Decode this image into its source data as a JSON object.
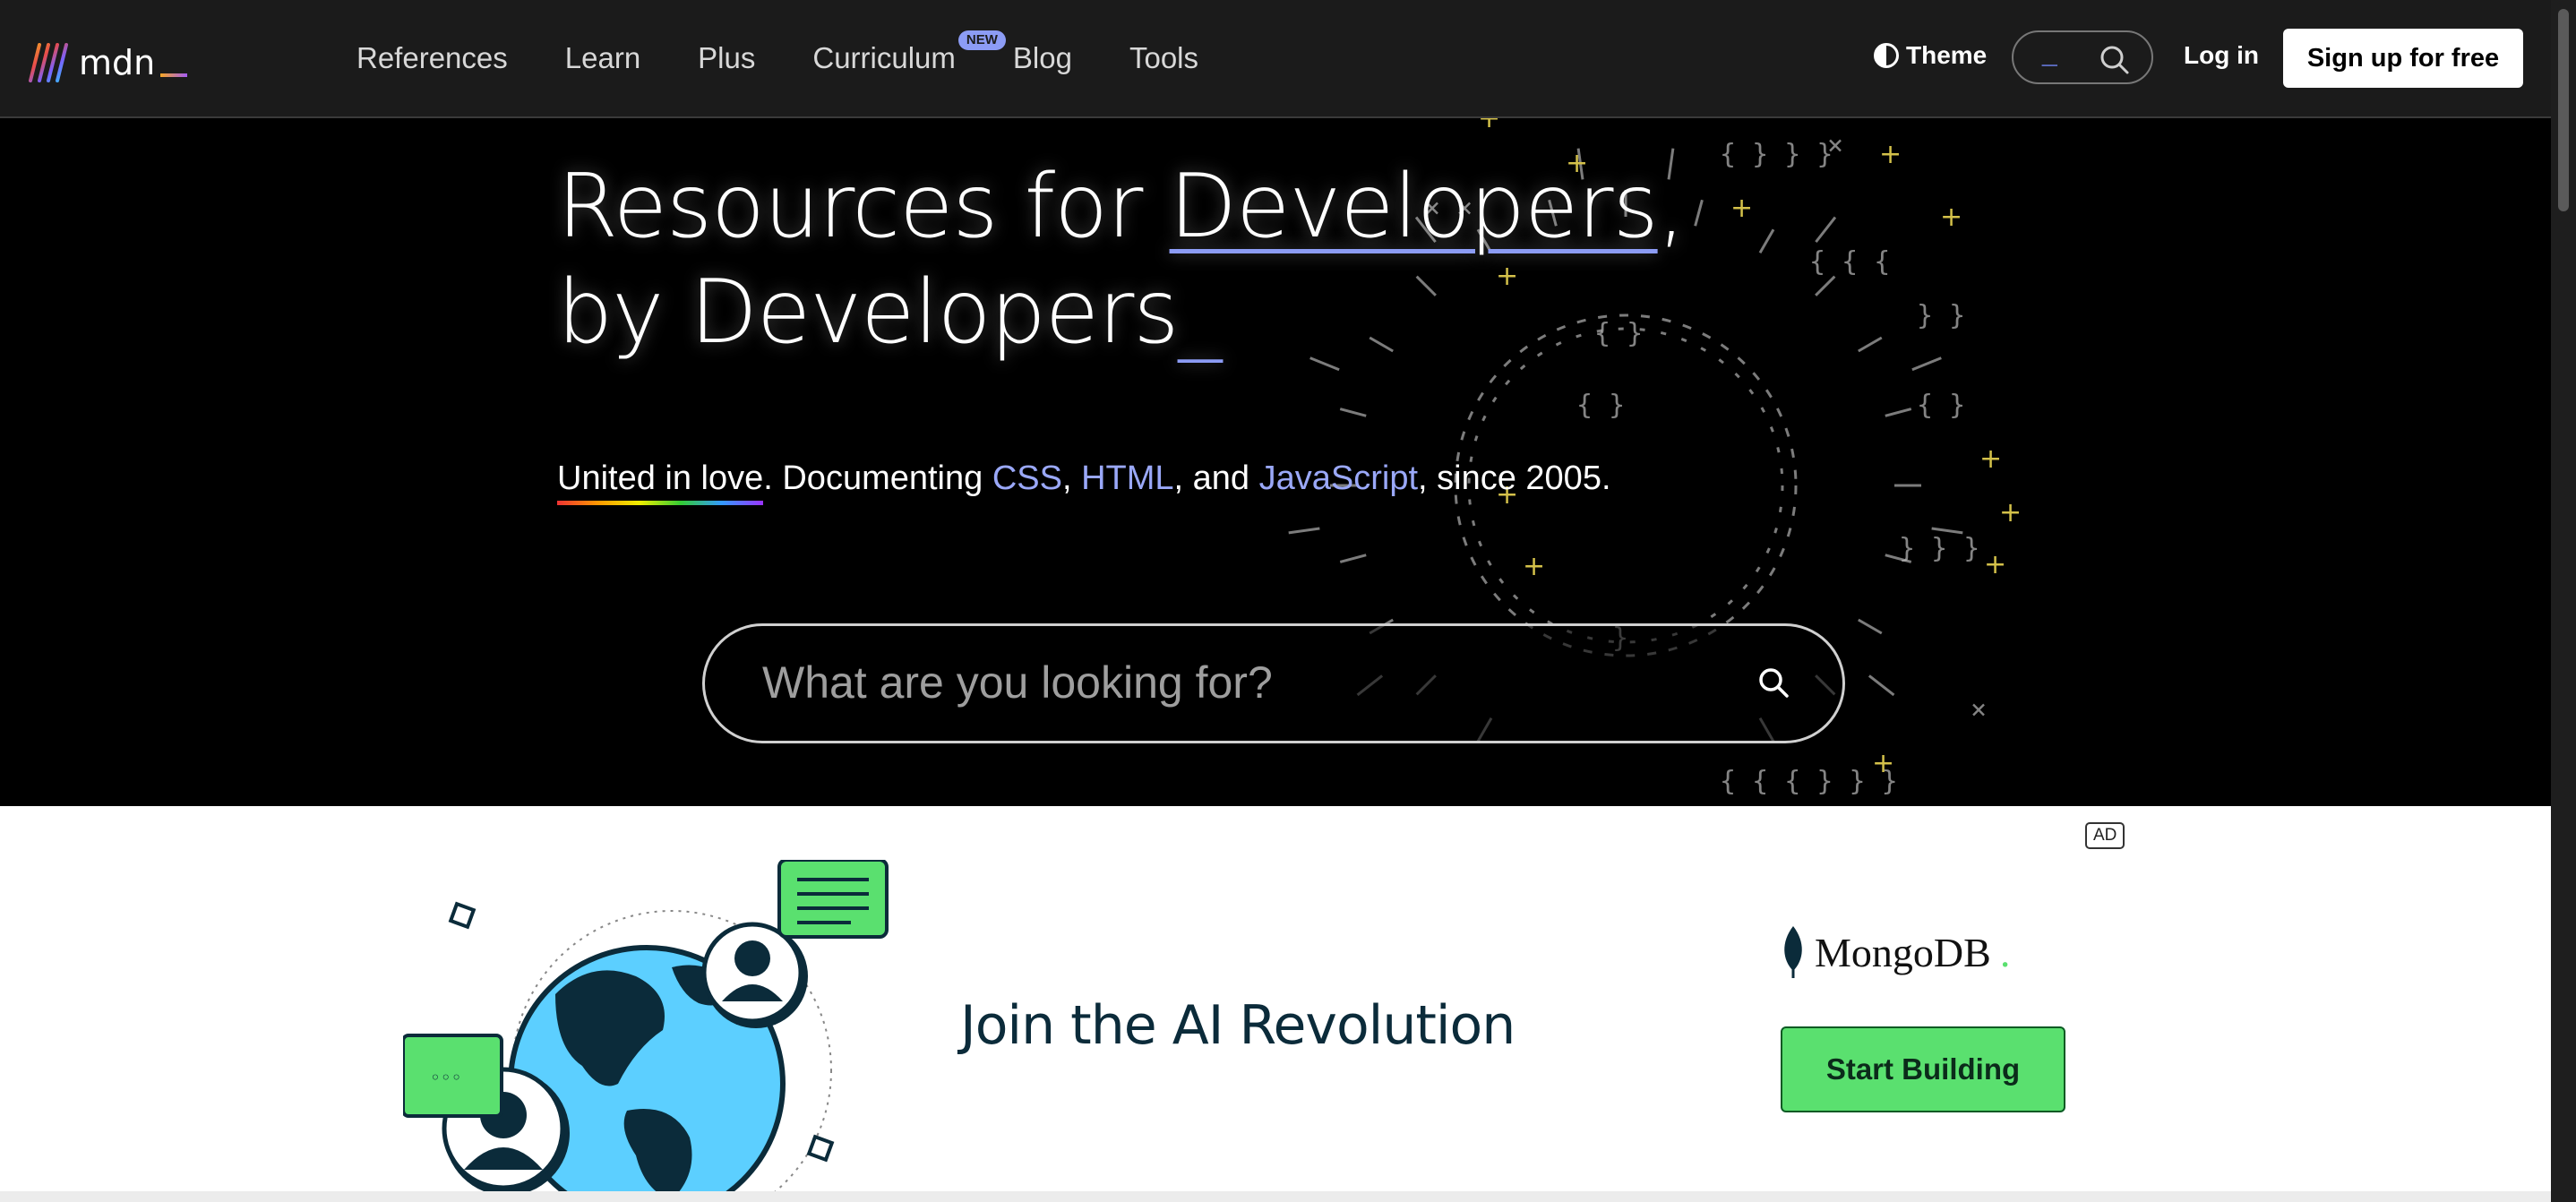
{
  "header": {
    "logo_text": "mdn",
    "nav": [
      "References",
      "Learn",
      "Plus",
      "Curriculum",
      "Blog",
      "Tools"
    ],
    "curriculum_badge": "NEW",
    "theme_label": "Theme",
    "search_placeholder": "_",
    "login_label": "Log in",
    "signup_label": "Sign up for free"
  },
  "hero": {
    "headline_prefix": "Resources for ",
    "headline_highlight": "Developers",
    "headline_comma": ",",
    "headline_line2": "by Developers",
    "headline_cursor": "_",
    "tagline_love": "United in love",
    "tagline_mid": ". Documenting ",
    "tagline_css": "CSS",
    "tagline_sep1": ", ",
    "tagline_html": "HTML",
    "tagline_sep2": ", and ",
    "tagline_js": "JavaScript",
    "tagline_end": ", since 2005.",
    "search_placeholder": "What are you looking for?"
  },
  "ad": {
    "label": "AD",
    "headline": "Join the AI Revolution",
    "brand": "MongoDB",
    "brand_mark": ".",
    "cta_label": "Start Building",
    "bubble_dots": "◦◦◦"
  },
  "colors": {
    "accent": "#8c9cf5",
    "header_bg": "#1b1b1b",
    "cta_green": "#5ae06f"
  },
  "icons": [
    "mdn-logo-icon",
    "theme-icon",
    "search-icon",
    "mongodb-leaf-icon"
  ]
}
